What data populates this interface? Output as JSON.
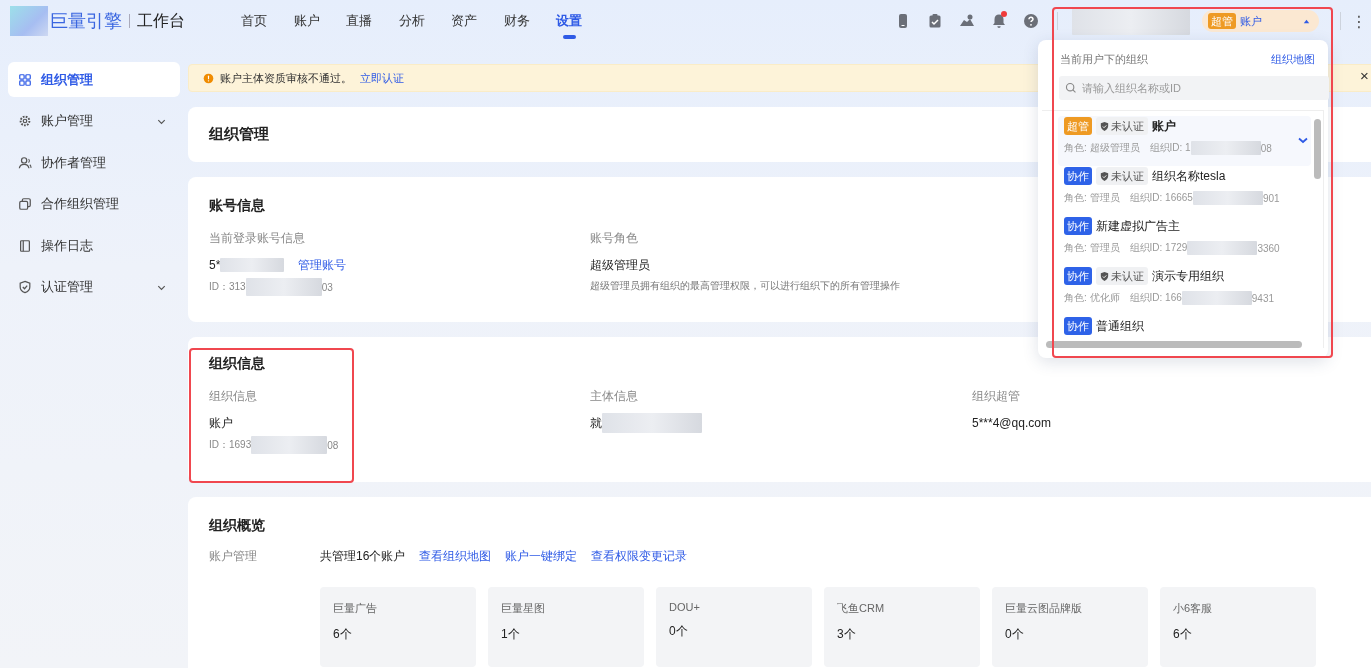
{
  "logo": {
    "brand": "巨量引擎",
    "product": "工作台"
  },
  "nav": [
    {
      "label": "首页",
      "selected": false
    },
    {
      "label": "账户",
      "selected": false
    },
    {
      "label": "直播",
      "selected": false
    },
    {
      "label": "分析",
      "selected": false
    },
    {
      "label": "资产",
      "selected": false
    },
    {
      "label": "财务",
      "selected": false
    },
    {
      "label": "设置",
      "selected": true
    }
  ],
  "toolbar": {
    "notification_dot": true,
    "more": "⋮"
  },
  "account_switch": {
    "badge": "超管",
    "name": "账户",
    "expanded": true
  },
  "sidebar": [
    {
      "label": "组织管理",
      "selected": true,
      "expandable": false
    },
    {
      "label": "账户管理",
      "selected": false,
      "expandable": true
    },
    {
      "label": "协作者管理",
      "selected": false,
      "expandable": false
    },
    {
      "label": "合作组织管理",
      "selected": false,
      "expandable": false
    },
    {
      "label": "操作日志",
      "selected": false,
      "expandable": false
    },
    {
      "label": "认证管理",
      "selected": false,
      "expandable": true
    }
  ],
  "alert": {
    "message": "账户主体资质审核不通过。",
    "link": "立即认证",
    "close": "×"
  },
  "page_title": "组织管理",
  "account_info": {
    "title": "账号信息",
    "login_label": "当前登录账号信息",
    "login_prefix": "5*",
    "manage_link": "管理账号",
    "id_prefix": "ID：313",
    "id_suffix": "03",
    "role_label": "账号角色",
    "role": "超级管理员",
    "role_desc": "超级管理员拥有组织的最高管理权限，可以进行组织下的所有管理操作"
  },
  "org_info": {
    "title": "组织信息",
    "org_label": "组织信息",
    "org_name": "账户",
    "id_prefix": "ID：1693",
    "id_suffix": "08",
    "subject_label": "主体信息",
    "subject_prefix": "就",
    "admin_label": "组织超管",
    "admin": "5***4@qq.com"
  },
  "overview": {
    "title": "组织概览",
    "label": "账户管理",
    "summary": "共管理16个账户",
    "links": [
      "查看组织地图",
      "账户一键绑定",
      "查看权限变更记录"
    ],
    "products": [
      {
        "name": "巨量广告",
        "count": "6个"
      },
      {
        "name": "巨量星图",
        "count": "1个"
      },
      {
        "name": "DOU+",
        "count": "0个"
      },
      {
        "name": "飞鱼CRM",
        "count": "3个"
      },
      {
        "name": "巨量云图品牌版",
        "count": "0个"
      },
      {
        "name": "小6客服",
        "count": "6个"
      }
    ]
  },
  "org_dropdown": {
    "heading": "当前用户下的组织",
    "map_link": "组织地图",
    "search_placeholder": "请输入组织名称或ID",
    "orgs": [
      {
        "badge": "超管",
        "color": "#ee9a23",
        "tag": "未认证",
        "name": "账户",
        "role": "角色: 超级管理员",
        "id_prefix": "组织ID: 1",
        "id_suffix": "08",
        "selected": true
      },
      {
        "badge": "协作",
        "color": "#2e62e8",
        "tag": "未认证",
        "name": "组织名称tesla",
        "role": "角色: 管理员",
        "id_prefix": "组织ID: 16665",
        "id_suffix": "901",
        "selected": false
      },
      {
        "badge": "协作",
        "color": "#2e62e8",
        "name": "新建虚拟广告主",
        "role": "角色: 管理员",
        "id_prefix": "组织ID: 1729",
        "id_suffix": "3360",
        "selected": false
      },
      {
        "badge": "协作",
        "color": "#2e62e8",
        "tag": "未认证",
        "name": "演示专用组织",
        "role": "角色: 优化师",
        "id_prefix": "组织ID: 166",
        "id_suffix": "9431",
        "selected": false
      },
      {
        "badge": "协作",
        "color": "#2e62e8",
        "name": "普通组织",
        "selected": false
      }
    ]
  }
}
